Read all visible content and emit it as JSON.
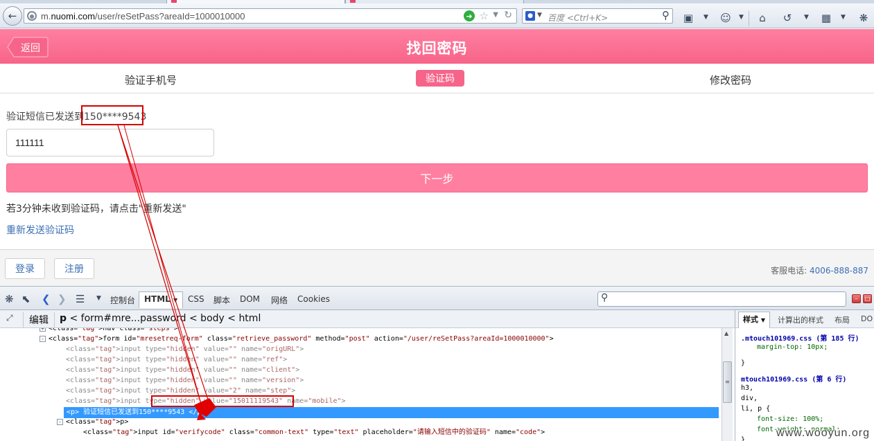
{
  "browser": {
    "url_prefix": "m.",
    "url_host": "nuomi.com",
    "url_path": "/user/reSetPass?areaId=1000010000",
    "search_placeholder": "百度 <Ctrl+K>",
    "search_engine_icon": "baidu-paw-icon"
  },
  "page": {
    "back_label": "返回",
    "title": "找回密码",
    "steps": [
      {
        "label": "验证手机号"
      },
      {
        "label": "验证码"
      },
      {
        "label": "修改密码"
      }
    ],
    "sent_prefix": "验证短信已发送到",
    "sent_phone": "150****9543",
    "code_value": "111111",
    "next_label": "下一步",
    "hint": "若3分钟未收到验证码，请点击\"重新发送\"",
    "resend_label": "重新发送验证码",
    "login_label": "登录",
    "register_label": "注册",
    "service_label": "客服电话:",
    "service_phone": "4006-888-887"
  },
  "colors": {
    "brand_pink": "#f7648a",
    "button_pink": "#ff7fa0",
    "link_blue": "#3b6fb5",
    "selection_blue": "#3399ff",
    "annotation_red": "#d40000"
  },
  "firebug": {
    "tabs": [
      "控制台",
      "HTML",
      "CSS",
      "脚本",
      "DOM",
      "网络",
      "Cookies"
    ],
    "active_tab": "HTML",
    "edit_label": "编辑",
    "breadcrumb_current": "p",
    "breadcrumb_rest": "< form#mre...password < body < html",
    "side_tabs": [
      "样式",
      "计算出的样式",
      "布局",
      "DO"
    ],
    "code_lines": [
      {
        "t": "<nav class=\"steps\">",
        "tw": "+"
      },
      {
        "t": "<form id=\"mresetreq-form\" class=\"retrieve_password\" method=\"post\" action=\"/user/reSetPass?areaId=1000010000\">",
        "tw": "-"
      },
      {
        "t": "<input type=\"hidden\" value=\"\" name=\"origURL\">"
      },
      {
        "t": "<input type=\"hidden\" value=\"\" name=\"ref\">"
      },
      {
        "t": "<input type=\"hidden\" value=\"\" name=\"client\">"
      },
      {
        "t": "<input type=\"hidden\" value=\"\" name=\"version\">"
      },
      {
        "t": "<input type=\"hidden\" value=\"2\" name=\"step\">"
      },
      {
        "t": "<input type=\"hidden\" value=\"15011119543\" name=\"mobile\">"
      },
      {
        "t": "<p> 验证短信已发送到150****9543 </p>"
      },
      {
        "t": "<p>",
        "tw": "-"
      },
      {
        "t": "<input id=\"verifycode\" class=\"common-text\" type=\"text\" placeholder=\"请输入短信中的验证码\" name=\"code\">"
      }
    ],
    "side_lines": [
      {
        "t": ".mtouch101969.css (第 185 行)",
        "k": "src"
      },
      {
        "t": "margin-top: 10px;",
        "k": "prop"
      },
      {
        "t": "}",
        "k": "plain"
      },
      {
        "t": "mtouch101969.css (第 6 行)",
        "k": "src"
      },
      {
        "t": "h3,",
        "k": "plain"
      },
      {
        "t": "div,",
        "k": "plain"
      },
      {
        "t": "li, p {",
        "k": "plain"
      },
      {
        "t": "font-size: 100%;",
        "k": "prop"
      },
      {
        "t": "font-weight: normal;",
        "k": "prop"
      },
      {
        "t": "}",
        "k": "plain"
      }
    ]
  },
  "watermark": "www.wooyun.org"
}
